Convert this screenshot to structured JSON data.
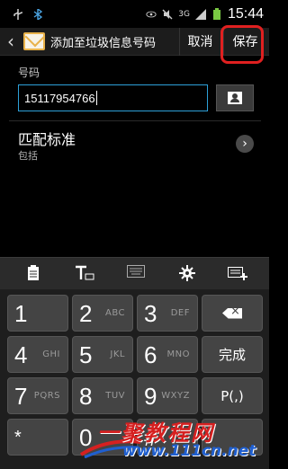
{
  "statusbar": {
    "network_label": "3G",
    "time": "15:44",
    "icons": [
      "usb-icon",
      "bluetooth-icon",
      "visibility-icon",
      "silent-icon",
      "signal-icon",
      "battery-icon"
    ]
  },
  "actionbar": {
    "title": "添加至垃圾信息号码",
    "cancel_label": "取消",
    "save_label": "保存"
  },
  "form": {
    "number_label": "号码",
    "number_value": "15117954766",
    "match_title": "匹配标准",
    "match_value": "包括"
  },
  "keyboard": {
    "tools": [
      "clipboard-icon",
      "text-input-icon",
      "keyboard-icon",
      "settings-gear-icon",
      "keyboard-add-icon"
    ],
    "rows": [
      [
        {
          "num": "1",
          "letters": ""
        },
        {
          "num": "2",
          "letters": "ABC"
        },
        {
          "num": "3",
          "letters": "DEF"
        }
      ],
      [
        {
          "num": "4",
          "letters": "GHI"
        },
        {
          "num": "5",
          "letters": "JKL"
        },
        {
          "num": "6",
          "letters": "MNO"
        }
      ],
      [
        {
          "num": "7",
          "letters": "PQRS"
        },
        {
          "num": "8",
          "letters": "TUV"
        },
        {
          "num": "9",
          "letters": "WXYZ"
        }
      ],
      [
        {
          "num": "*",
          "letters": ""
        },
        {
          "num": "0",
          "letters": ""
        },
        {
          "num": "#",
          "letters": ""
        }
      ]
    ],
    "done_label": "完成",
    "pause_label": "P(,)"
  },
  "watermark": {
    "chinese": "一聚教程网",
    "url": "www.111cn.net"
  },
  "colors": {
    "accent": "#2da0d8",
    "highlight_ring": "#e02020",
    "watermark_red": "#d62020",
    "watermark_blue": "#1f5fd0"
  }
}
